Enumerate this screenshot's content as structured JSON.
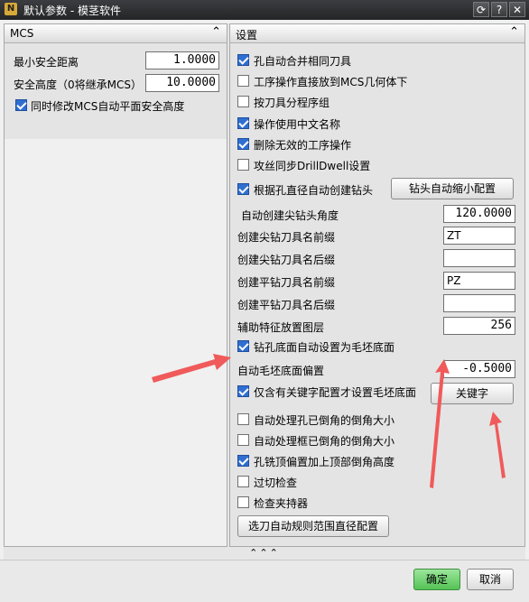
{
  "window": {
    "title": "默认参数 - 模茎软件",
    "refresh_glyph": "⟳",
    "help_glyph": "?",
    "close_glyph": "✕"
  },
  "mcs_panel": {
    "title": "MCS",
    "collapse_glyph": "⌃",
    "min_safe_distance_label": "最小安全距离",
    "min_safe_distance_value": "1.0000",
    "safe_height_label": "安全高度（0将继承MCS）",
    "safe_height_value": "10.0000",
    "sync_mcs_label": "同时修改MCS自动平面安全高度",
    "sync_mcs_checked": true
  },
  "settings_panel": {
    "title": "设置",
    "collapse_glyph": "⌃",
    "options": [
      {
        "label": "孔自动合并相同刀具",
        "checked": true
      },
      {
        "label": "工序操作直接放到MCS几何体下",
        "checked": false
      },
      {
        "label": "按刀具分程序组",
        "checked": false
      },
      {
        "label": "操作使用中文名称",
        "checked": true
      },
      {
        "label": "删除无效的工序操作",
        "checked": true
      },
      {
        "label": "攻丝同步DrillDwell设置",
        "checked": false
      },
      {
        "label": "根据孔直径自动创建钻头",
        "checked": true
      }
    ],
    "drill_auto_scale_button": "钻头自动缩小配置",
    "fields": [
      {
        "label": "自动创建尖钻头角度",
        "value": "120.0000"
      },
      {
        "label": "创建尖钻刀具名前缀",
        "value": "ZT"
      },
      {
        "label": "创建尖钻刀具名后缀",
        "value": ""
      },
      {
        "label": "创建平钻刀具名前缀",
        "value": "PZ"
      },
      {
        "label": "创建平钻刀具名后缀",
        "value": ""
      },
      {
        "label": "辅助特征放置图层",
        "value": "256"
      }
    ],
    "bottom_as_blank_label": "钻孔底面自动设置为毛坯底面",
    "bottom_as_blank_checked": true,
    "blank_offset_label": "自动毛坯底面偏置",
    "blank_offset_value": "-0.5000",
    "keyword_only_label": "仅含有关键字配置才设置毛坯底面",
    "keyword_only_checked": true,
    "keyword_button": "关键字",
    "options2": [
      {
        "label": "自动处理孔已倒角的倒角大小",
        "checked": false
      },
      {
        "label": "自动处理框已倒角的倒角大小",
        "checked": false
      },
      {
        "label": "孔铣顶偏置加上顶部倒角高度",
        "checked": true
      },
      {
        "label": "过切检查",
        "checked": false
      },
      {
        "label": "检查夹持器",
        "checked": false
      }
    ],
    "range_config_button": "选刀自动规则范围直径配置"
  },
  "expander_glyph": "⌃⌃⌃",
  "footer": {
    "ok_label": "确定",
    "cancel_label": "取消"
  },
  "colors": {
    "accent_check": "#2f6fd1",
    "ok_button_green": "#6ed06e",
    "annotation_arrow": "#f05a5a"
  }
}
